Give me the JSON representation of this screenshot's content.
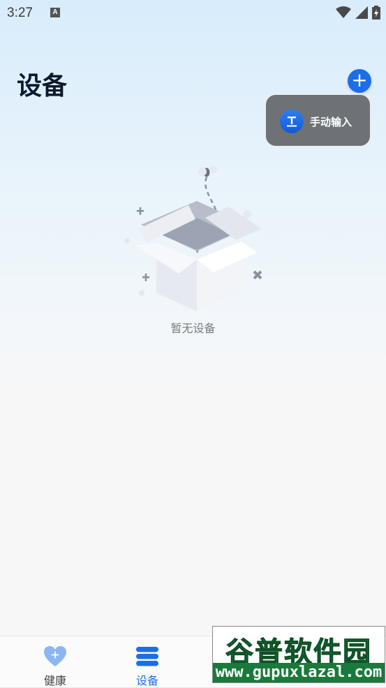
{
  "status_bar": {
    "time": "3:27",
    "notification_icon": "A",
    "icons": [
      "wifi-icon",
      "signal-icon",
      "battery-icon"
    ]
  },
  "header": {
    "title": "设备",
    "add_button_icon": "+"
  },
  "popup_menu": {
    "items": [
      {
        "label": "手动输入",
        "icon": "text-input-icon"
      }
    ]
  },
  "empty_state": {
    "message": "暂无设备",
    "icon": "empty-box-icon"
  },
  "bottom_nav": {
    "tabs": [
      {
        "label": "健康",
        "icon": "heart-plus-icon",
        "active": false
      },
      {
        "label": "设备",
        "icon": "device-stack-icon",
        "active": true
      },
      {
        "label": "",
        "icon": "discover-icon",
        "active": false
      },
      {
        "label": "",
        "icon": "profile-icon",
        "active": false
      }
    ]
  },
  "watermark": {
    "title": "谷普软件园",
    "url": "www.gupuxlazal.com"
  },
  "colors": {
    "accent": "#1b6ee8",
    "popup_bg": "#6e7276",
    "title": "#0b1a2e"
  }
}
